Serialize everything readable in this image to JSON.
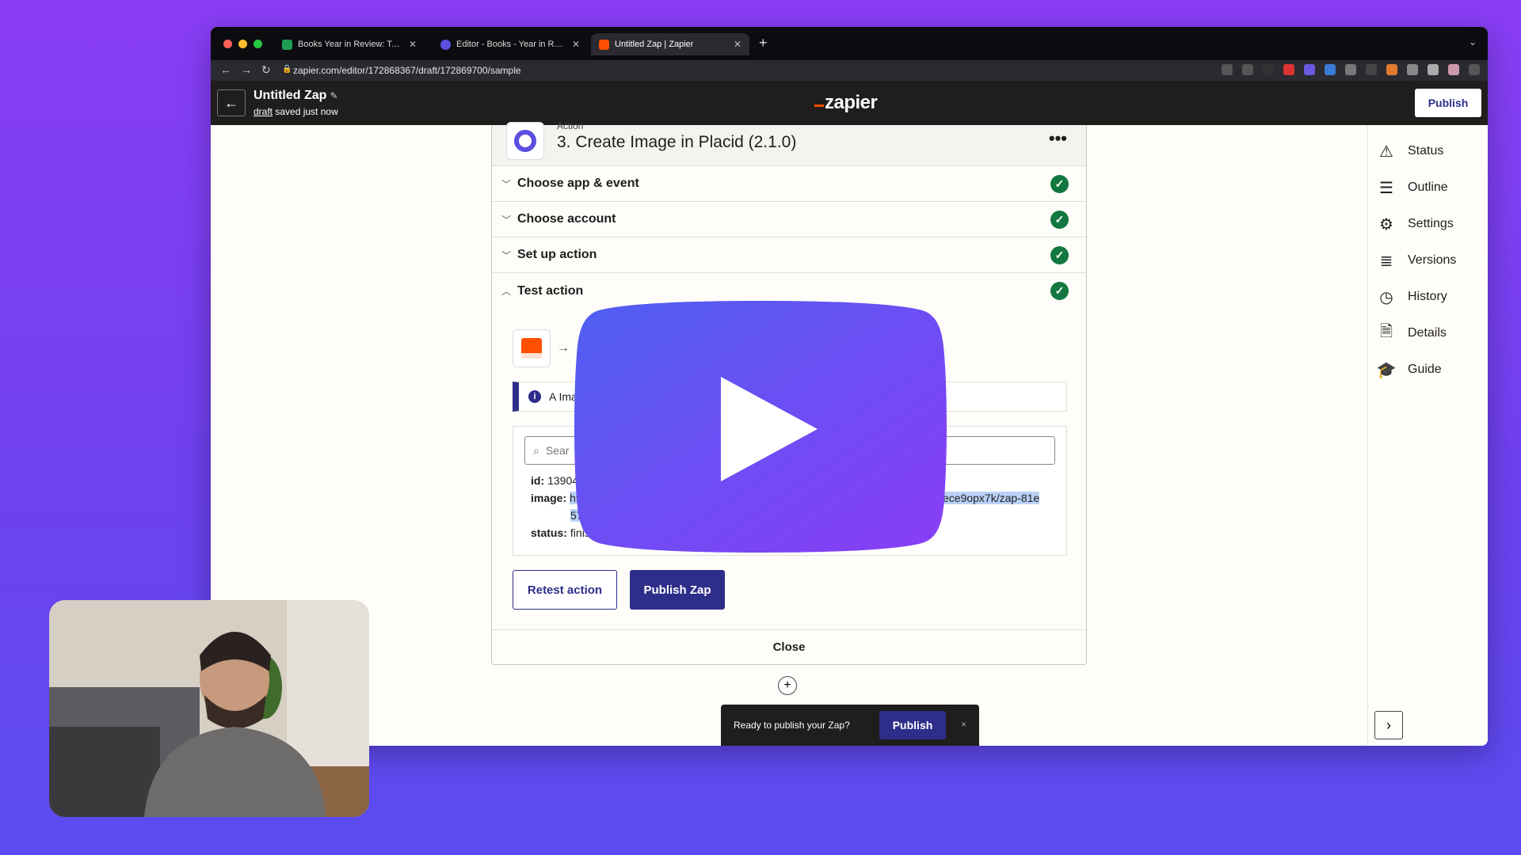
{
  "browser": {
    "tabs": [
      {
        "title": "Books Year in Review: Table 1 -",
        "favicon_color": "#1f9d55",
        "active": false
      },
      {
        "title": "Editor - Books - Year in Review",
        "favicon_color": "#5b4fe0",
        "active": false
      },
      {
        "title": "Untitled Zap | Zapier",
        "favicon_color": "#ff4f00",
        "active": true
      }
    ],
    "url": "zapier.com/editor/172868367/draft/172869700/sample"
  },
  "zap_header": {
    "title": "Untitled Zap",
    "draft_link": "draft",
    "saved_text": "saved just now",
    "logo": "zapier",
    "publish_label": "Publish"
  },
  "sidebar": {
    "items": [
      {
        "label": "Status",
        "icon": "warning-icon"
      },
      {
        "label": "Outline",
        "icon": "list-icon"
      },
      {
        "label": "Settings",
        "icon": "gear-icon"
      },
      {
        "label": "Versions",
        "icon": "stack-icon"
      },
      {
        "label": "History",
        "icon": "clock-icon"
      },
      {
        "label": "Details",
        "icon": "file-bolt-icon"
      },
      {
        "label": "Guide",
        "icon": "graduation-cap-icon"
      }
    ]
  },
  "step": {
    "action_label": "Action",
    "title": "3. Create Image in Placid (2.1.0)",
    "sections": [
      {
        "label": "Choose app & event",
        "done": true
      },
      {
        "label": "Choose account",
        "done": true
      },
      {
        "label": "Set up action",
        "done": true
      },
      {
        "label": "Test action",
        "done": true
      }
    ],
    "alert_text": "A Ima",
    "search_placeholder": "Sear",
    "result": {
      "id_label": "id:",
      "id_value": "13904",
      "image_label": "image:",
      "image_value_start": "ht",
      "image_value_end": "ece9opx7k/zap-81e",
      "image_value_line2": "57",
      "status_label": "status:",
      "status_value": "finis"
    },
    "retest_label": "Retest action",
    "publish_zap_label": "Publish Zap",
    "close_label": "Close"
  },
  "toast": {
    "text": "Ready to publish your Zap?",
    "button": "Publish",
    "dismiss": "×"
  },
  "colors": {
    "brand_orange": "#ff4f00",
    "primary": "#2d2e8a",
    "success": "#13783f"
  }
}
